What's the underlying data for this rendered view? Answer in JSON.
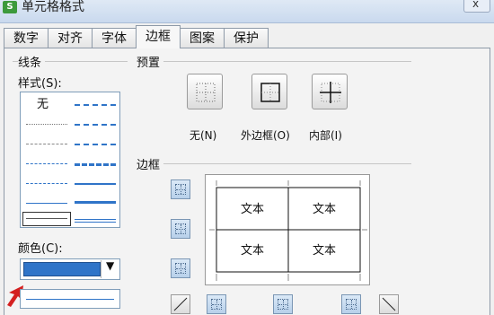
{
  "window": {
    "title": "单元格格式",
    "app_icon": "S",
    "close_glyph": "x"
  },
  "tabs": [
    {
      "label": "数字"
    },
    {
      "label": "对齐"
    },
    {
      "label": "字体"
    },
    {
      "label": "边框",
      "active": true
    },
    {
      "label": "图案"
    },
    {
      "label": "保护"
    }
  ],
  "line_group": {
    "title": "线条",
    "style_label": "样式(S):",
    "none_label": "无",
    "color_label": "颜色(C):",
    "color_value": "#2f74c8"
  },
  "presets": {
    "title": "预置",
    "items": [
      {
        "label": "无(N)"
      },
      {
        "label": "外边框(O)"
      },
      {
        "label": "内部(I)"
      }
    ]
  },
  "border": {
    "title": "边框",
    "cells": [
      "文本",
      "文本",
      "文本",
      "文本"
    ]
  },
  "colors": {
    "accent": "#2f74c8",
    "arrow": "#d42020"
  }
}
